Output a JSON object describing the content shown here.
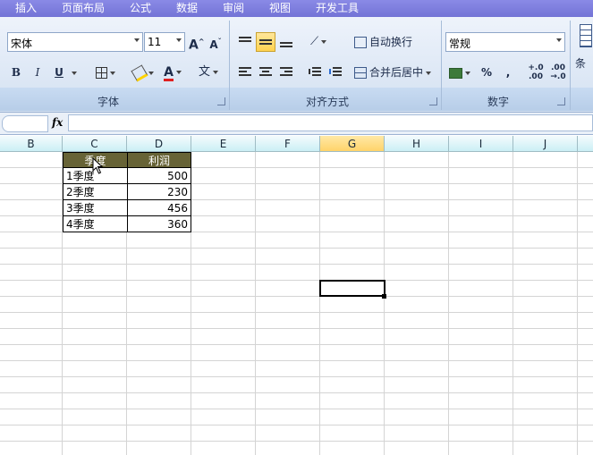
{
  "ribbon_tabs": [
    "插入",
    "页面布局",
    "公式",
    "数据",
    "审阅",
    "视图",
    "开发工具"
  ],
  "font": {
    "name": "宋体",
    "size": "11",
    "grow_icon": "A^",
    "shrink_icon": "A˅",
    "bold": "B",
    "italic": "I",
    "underline": "U",
    "font_color_label": "A",
    "pinyin_label": "文",
    "group_label": "字体"
  },
  "alignment": {
    "wrap_text": "自动换行",
    "merge_center": "合并后居中",
    "group_label": "对齐方式"
  },
  "number": {
    "format": "常规",
    "percent": "%",
    "comma": ",",
    "increase_decimal": "+.0 .00",
    "decrease_decimal": ".00 →.0",
    "group_label": "数字"
  },
  "styles": {
    "conditional_partial": "条件"
  },
  "formula_bar": {
    "fx": "fx",
    "name_box": "",
    "content": ""
  },
  "columns": [
    "B",
    "C",
    "D",
    "E",
    "F",
    "G",
    "H",
    "I",
    "J"
  ],
  "active_column": "G",
  "table": {
    "headers": [
      "季度",
      "利润"
    ],
    "rows": [
      {
        "quarter": "1季度",
        "profit": "500"
      },
      {
        "quarter": "2季度",
        "profit": "230"
      },
      {
        "quarter": "3季度",
        "profit": "456"
      },
      {
        "quarter": "4季度",
        "profit": "360"
      }
    ]
  },
  "colors": {
    "tab_bar": "#7f7fe0",
    "header_fill": "#676336",
    "active_col_header": "#ffd36a",
    "grid_line": "#d4d4d4"
  }
}
